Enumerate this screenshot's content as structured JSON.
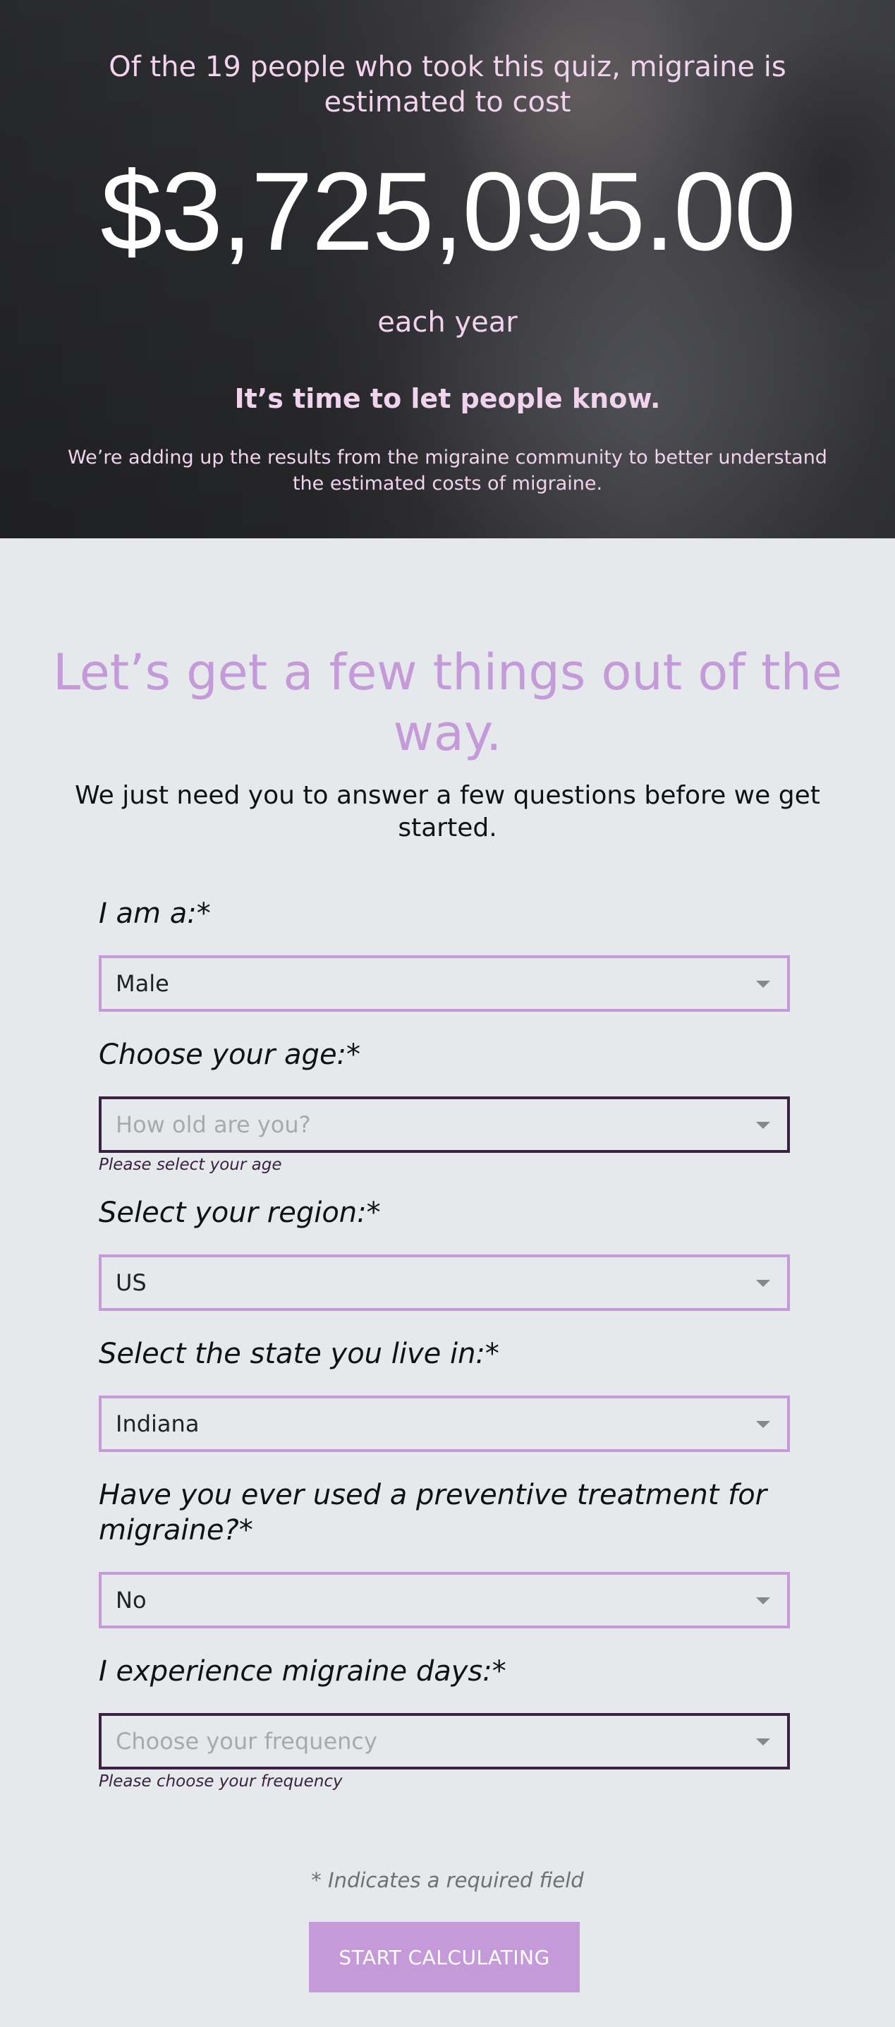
{
  "hero": {
    "lead": "Of the 19 people who took this quiz, migraine is estimated to cost",
    "amount": "$3,725,095.00",
    "period": "each year",
    "cta": "It’s time to let people know.",
    "description": "We’re adding up the results from the migraine community to better understand the estimated costs of migraine."
  },
  "intro": {
    "title": "Let’s get a few things out of the way.",
    "subtitle": "We just need you to answer a few questions before we get started."
  },
  "form": {
    "fields": [
      {
        "label": "I am a:*",
        "value": "Male",
        "placeholder": "",
        "error": ""
      },
      {
        "label": "Choose your age:*",
        "value": "",
        "placeholder": "How old are you?",
        "error": "Please select your age"
      },
      {
        "label": "Select your region:*",
        "value": "US",
        "placeholder": "",
        "error": ""
      },
      {
        "label": "Select the state you live in:*",
        "value": "Indiana",
        "placeholder": "",
        "error": ""
      },
      {
        "label": "Have you ever used a preventive treatment for migraine?*",
        "value": "No",
        "placeholder": "",
        "error": ""
      },
      {
        "label": "I experience migraine days:*",
        "value": "",
        "placeholder": "Choose your frequency",
        "error": "Please choose your frequency"
      }
    ],
    "required_note": "* Indicates a required field",
    "submit_label": "START CALCULATING"
  },
  "colors": {
    "accent": "#c49ad8",
    "error_border": "#3b2240",
    "background": "#e6e9eb"
  },
  "icons": {
    "select_chevron": "chevron-down-icon"
  }
}
